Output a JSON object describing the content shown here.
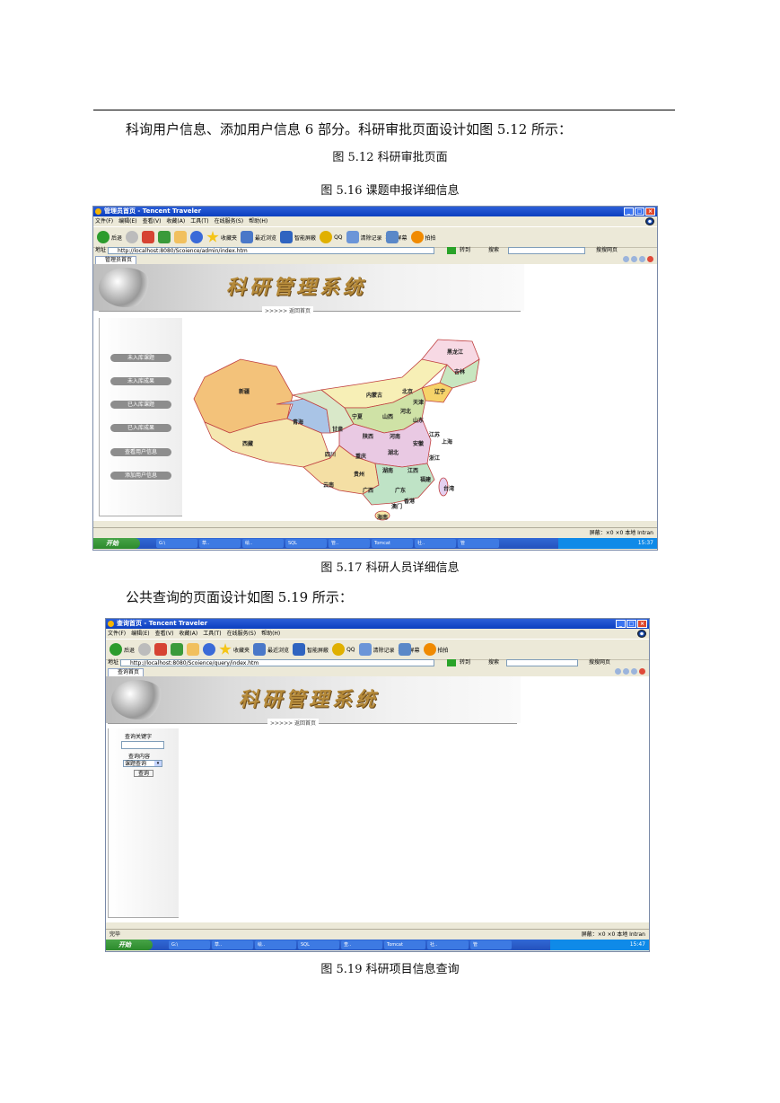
{
  "doc": {
    "intro_line": "科询用户信息、添加用户信息 6 部分。科研审批页面设计如图 5.12 所示：",
    "caption_512": "图 5.12 科研审批页面",
    "caption_516": "图 5.16 课题申报详细信息",
    "caption_517": "图 5.17 科研人员详细信息",
    "query_line": "公共查询的页面设计如图 5.19 所示：",
    "caption_519": "图 5.19 科研项目信息查询"
  },
  "shot1": {
    "window_title": "管理员首页 - Tencent Traveler",
    "menu": [
      "文件(F)",
      "编辑(E)",
      "查看(V)",
      "收藏(A)",
      "工具(T)",
      "在线服务(S)",
      "帮助(H)"
    ],
    "toolbar": {
      "back": "后退",
      "favorites": "收藏夹",
      "recent": "最近浏览",
      "smart": "智能屏蔽",
      "qq": "QQ",
      "clear": "清除记录",
      "capture": "捕捉屏幕",
      "paipai": "拍拍"
    },
    "address_label": "地址",
    "address_value": "http://localhost:8080/Scoience/admin/index.htm",
    "go_label": "转到",
    "search_label": "搜索",
    "search_web": "搜搜网页",
    "tab_label": "管理员首页",
    "banner_title": "科研管理系统",
    "nav_text": ">>>>>  返回首页",
    "sidebar_items": [
      "未入库课题",
      "未入库成果",
      "已入库课题",
      "已入库成果",
      "查看用户信息",
      "添加用户信息"
    ],
    "map_provinces": [
      "黑龙江",
      "吉林",
      "辽宁",
      "内蒙古",
      "北京",
      "天津",
      "新疆",
      "青海",
      "甘肃",
      "宁夏",
      "山西",
      "河北",
      "山东",
      "陕西",
      "河南",
      "江苏",
      "上海",
      "安徽",
      "西藏",
      "四川",
      "重庆",
      "湖北",
      "浙江",
      "贵州",
      "湖南",
      "江西",
      "福建",
      "云南",
      "广西",
      "广东",
      "香港",
      "澳门",
      "台湾",
      "海南"
    ],
    "status_right": "屏蔽：×0  ×0     本地 Intran",
    "taskbar_start": "开始",
    "taskbar_items": [
      "G:\\",
      "草..",
      "绘..",
      "SQL",
      "管..",
      "Tomcat",
      "社..",
      "管"
    ],
    "clock": "15:37"
  },
  "shot2": {
    "window_title": "查询首页 - Tencent Traveler",
    "menu": [
      "文件(F)",
      "编辑(E)",
      "查看(V)",
      "收藏(A)",
      "工具(T)",
      "在线服务(S)",
      "帮助(H)"
    ],
    "toolbar": {
      "back": "后退",
      "favorites": "收藏夹",
      "recent": "最近浏览",
      "smart": "智能屏蔽",
      "qq": "QQ",
      "clear": "清除记录",
      "capture": "捕捉屏幕",
      "paipai": "拍拍"
    },
    "address_label": "地址",
    "address_value": "http://localhost:8080/Scoience/query/index.htm",
    "go_label": "转到",
    "search_label": "搜索",
    "search_web": "搜搜网页",
    "tab_label": "查询首页",
    "banner_title": "科研管理系统",
    "nav_text": ">>>>>  返回首页",
    "keyword_label": "查询关键字",
    "content_label": "查询内容",
    "select_value": "课题查询",
    "query_button": "查询",
    "status_left": "完毕",
    "status_right": "屏蔽：×0  ×0     本地 Intran",
    "taskbar_start": "开始",
    "taskbar_items": [
      "G:\\",
      "草..",
      "绘..",
      "SQL",
      "查..",
      "Tomcat",
      "社..",
      "管"
    ],
    "clock": "15:47"
  },
  "colors": {
    "titlebar": "#0b3fbf",
    "banner_gold": "#b58a3a",
    "pill_gray": "#8d8d8d"
  }
}
